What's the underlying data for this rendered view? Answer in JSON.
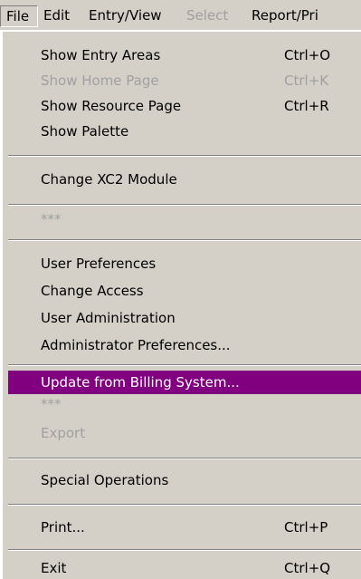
{
  "menubar": {
    "items": [
      {
        "label": "File",
        "state": "pressed"
      },
      {
        "label": "Edit",
        "state": "normal"
      },
      {
        "label": "Entry/View",
        "state": "normal"
      },
      {
        "label": "Select",
        "state": "disabled"
      },
      {
        "label": "Report/Pri",
        "state": "normal"
      }
    ]
  },
  "file_menu": {
    "items": [
      {
        "label": "Show Entry Areas",
        "shortcut": "Ctrl+O",
        "state": "normal"
      },
      {
        "label": "Show Home Page",
        "shortcut": "Ctrl+K",
        "state": "disabled"
      },
      {
        "label": "Show Resource Page",
        "shortcut": "Ctrl+R",
        "state": "normal"
      },
      {
        "label": "Show Palette",
        "shortcut": "",
        "state": "normal"
      },
      {
        "label": "Change XC2 Module",
        "shortcut": "",
        "state": "normal"
      },
      {
        "label": "***",
        "shortcut": "",
        "state": "disabled"
      },
      {
        "label": "User Preferences",
        "shortcut": "",
        "state": "normal"
      },
      {
        "label": "Change Access",
        "shortcut": "",
        "state": "normal"
      },
      {
        "label": "User Administration",
        "shortcut": "",
        "state": "normal"
      },
      {
        "label": "Administrator Preferences...",
        "shortcut": "",
        "state": "normal"
      },
      {
        "label": "Update from Billing System...",
        "shortcut": "",
        "state": "highlighted"
      },
      {
        "label": "***",
        "shortcut": "",
        "state": "disabled"
      },
      {
        "label": "Export",
        "shortcut": "",
        "state": "disabled"
      },
      {
        "label": "Special Operations",
        "shortcut": "",
        "state": "normal"
      },
      {
        "label": "Print...",
        "shortcut": "Ctrl+P",
        "state": "normal"
      },
      {
        "label": "Exit",
        "shortcut": "Ctrl+Q",
        "state": "normal"
      }
    ]
  },
  "colors": {
    "menu_background": "#d4d0c8",
    "highlight": "#800080",
    "disabled_text": "#a0a0a0"
  }
}
